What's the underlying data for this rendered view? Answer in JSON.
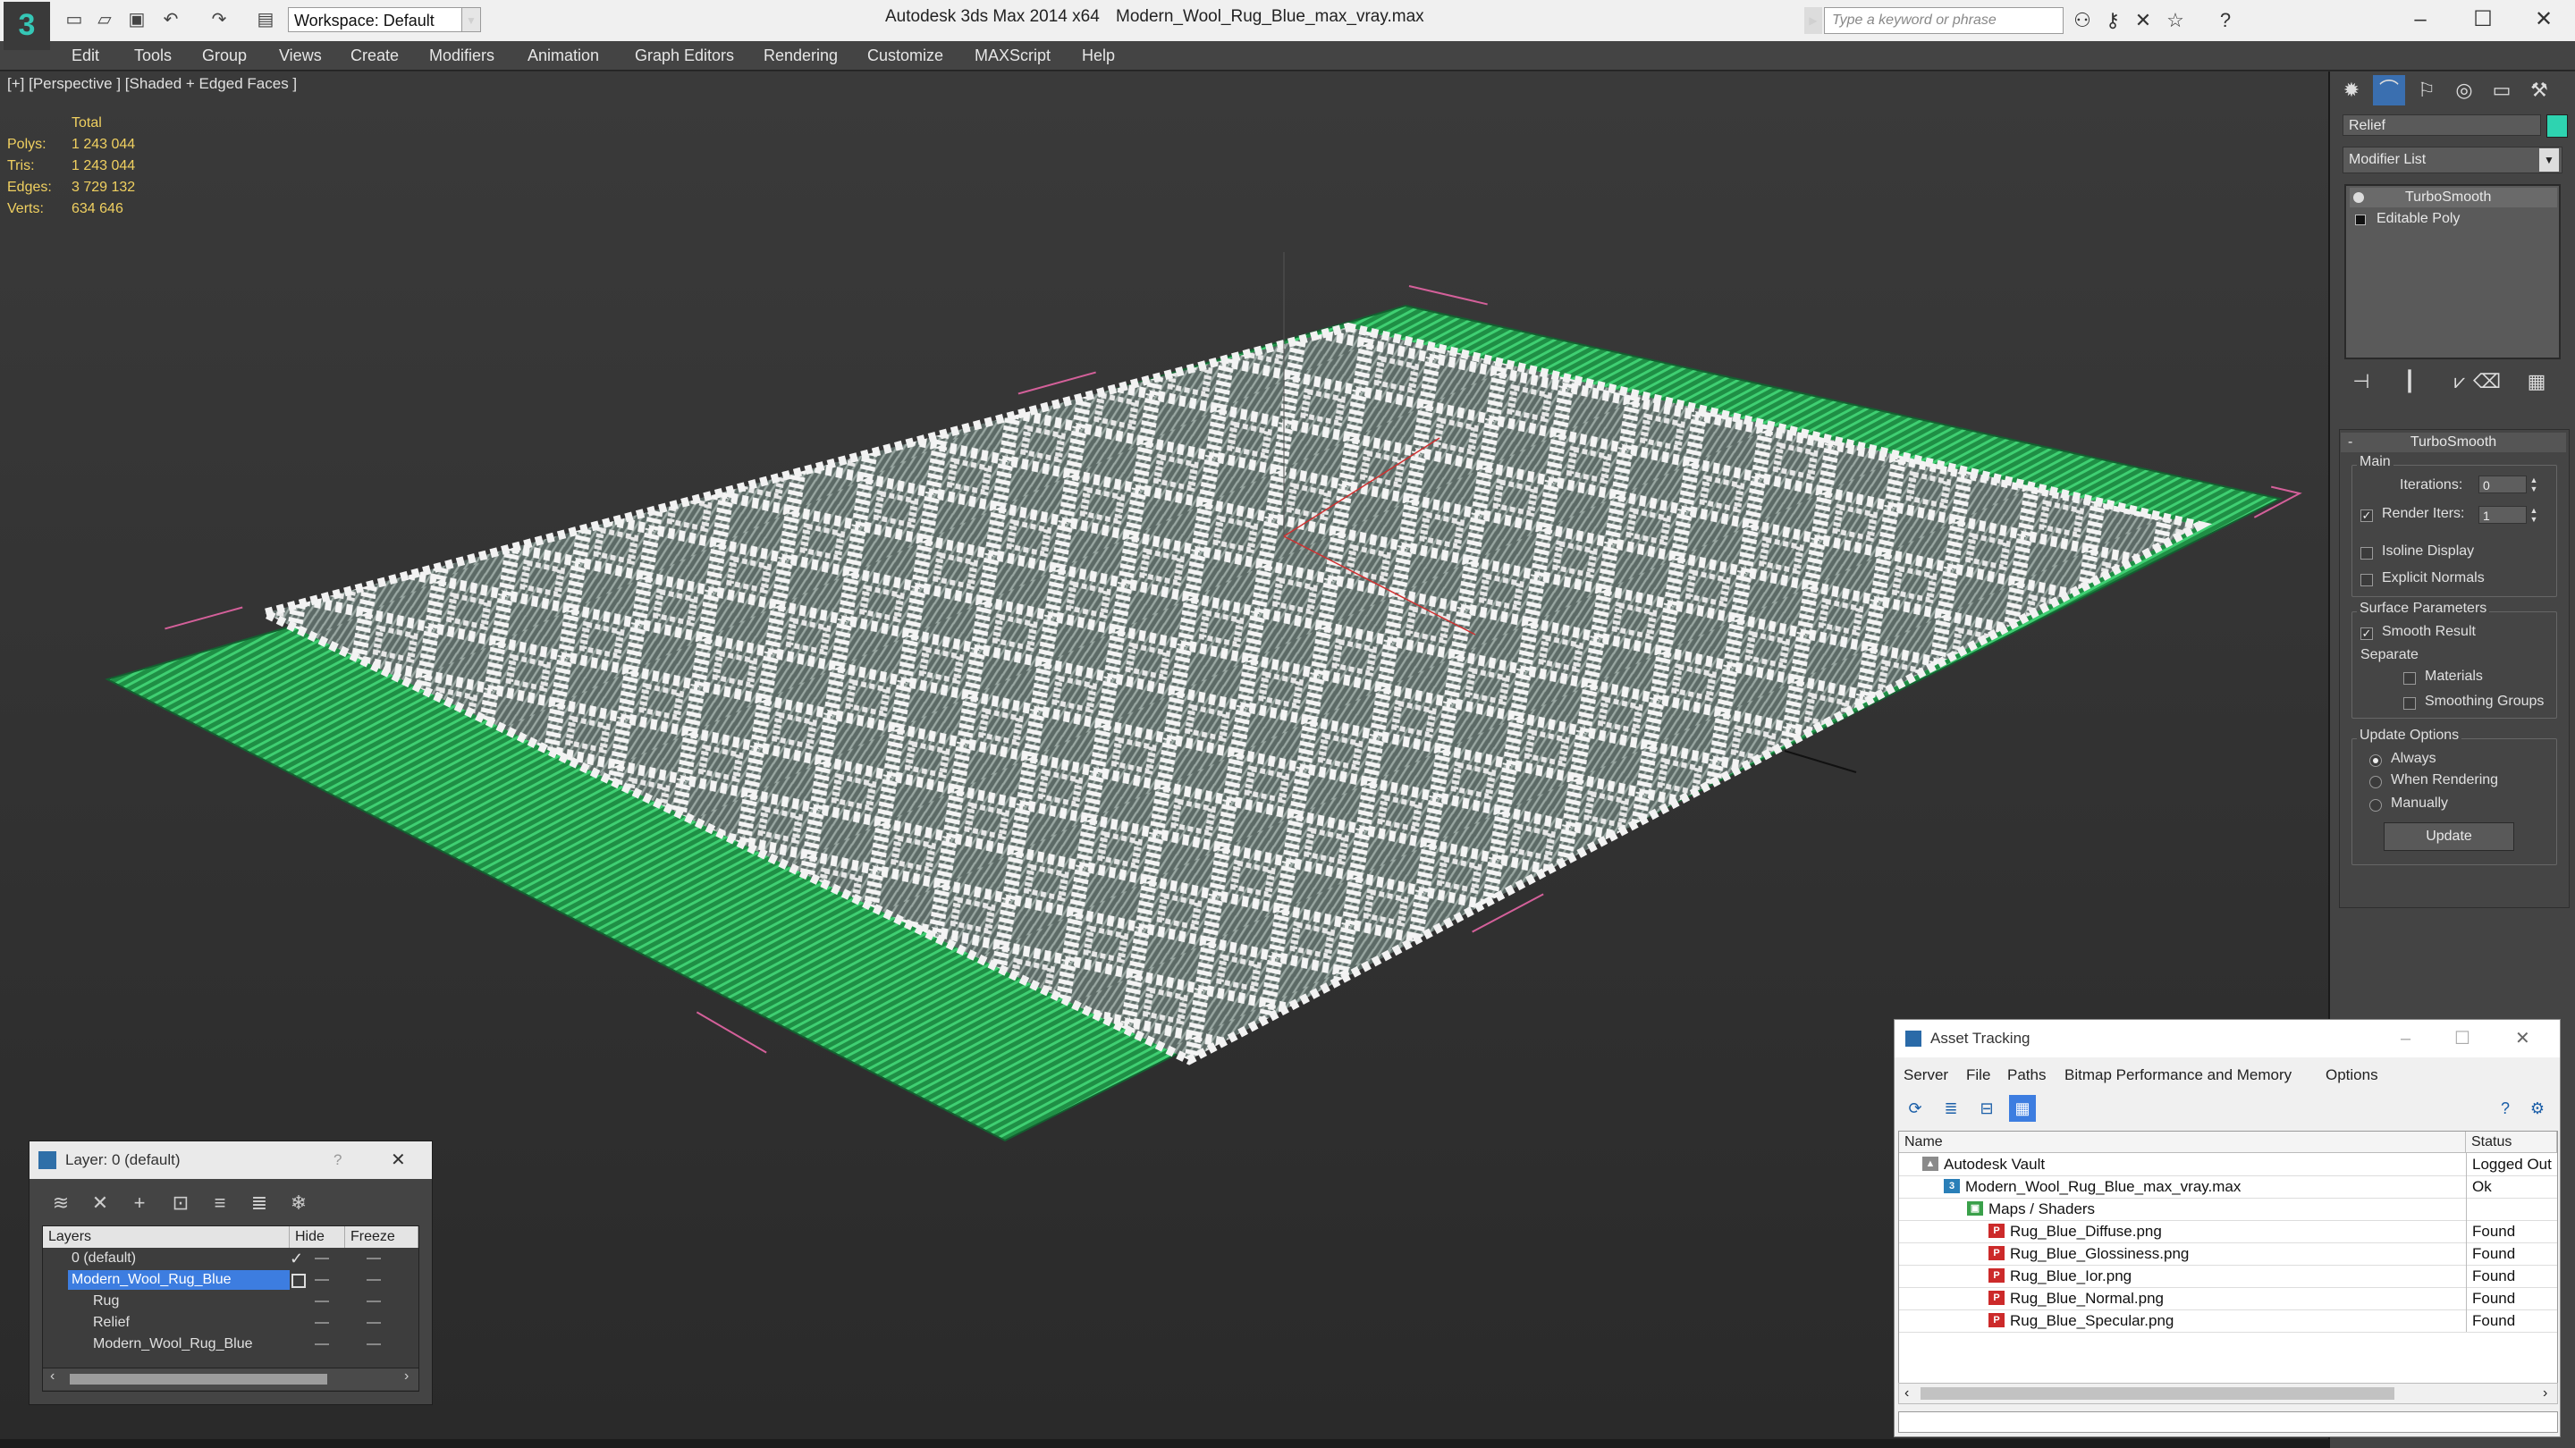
{
  "titlebar": {
    "workspace": "Workspace: Default",
    "app_title": "Autodesk 3ds Max  2014 x64",
    "doc_title": "Modern_Wool_Rug_Blue_max_vray.max",
    "search_placeholder": "Type a keyword or phrase"
  },
  "menu": [
    "Edit",
    "Tools",
    "Group",
    "Views",
    "Create",
    "Modifiers",
    "Animation",
    "Graph Editors",
    "Rendering",
    "Customize",
    "MAXScript",
    "Help"
  ],
  "viewport": {
    "label": "[+] [Perspective ] [Shaded + Edged Faces ]",
    "stats_header": "Total",
    "stats": [
      {
        "label": "Polys:",
        "value": "1 243 044"
      },
      {
        "label": "Tris:",
        "value": "1 243 044"
      },
      {
        "label": "Edges:",
        "value": "3 729 132"
      },
      {
        "label": "Verts:",
        "value": "634 646"
      }
    ]
  },
  "command_panel": {
    "object_name": "Relief",
    "object_color": "#2ed3b0",
    "modifier_list": "Modifier List",
    "stack": [
      "TurboSmooth",
      "Editable Poly"
    ],
    "rollout_title": "TurboSmooth",
    "main_group": "Main",
    "iterations_label": "Iterations:",
    "iterations_value": "0",
    "render_iters_label": "Render Iters:",
    "render_iters_value": "1",
    "isoline": "Isoline Display",
    "explicit_normals": "Explicit Normals",
    "surface_group": "Surface Parameters",
    "smooth_result": "Smooth Result",
    "separate": "Separate",
    "materials": "Materials",
    "smoothing_groups": "Smoothing Groups",
    "update_group": "Update Options",
    "always": "Always",
    "when_rendering": "When Rendering",
    "manually": "Manually",
    "update_button": "Update"
  },
  "layer_dialog": {
    "title": "Layer: 0 (default)",
    "help": "?",
    "col_layers": "Layers",
    "col_hide": "Hide",
    "col_freeze": "Freeze",
    "rows": [
      {
        "name": "0 (default)"
      },
      {
        "name": "Modern_Wool_Rug_Blue"
      },
      {
        "name": "Rug"
      },
      {
        "name": "Relief"
      },
      {
        "name": "Modern_Wool_Rug_Blue"
      }
    ]
  },
  "asset_tracking": {
    "title": "Asset Tracking",
    "menu": [
      "Server",
      "File",
      "Paths",
      "Bitmap Performance and Memory",
      "Options"
    ],
    "col_name": "Name",
    "col_status": "Status",
    "rows": [
      {
        "name": "Autodesk Vault",
        "status": "Logged Out"
      },
      {
        "name": "Modern_Wool_Rug_Blue_max_vray.max",
        "status": "Ok"
      },
      {
        "name": "Maps / Shaders",
        "status": ""
      },
      {
        "name": "Rug_Blue_Diffuse.png",
        "status": "Found"
      },
      {
        "name": "Rug_Blue_Glossiness.png",
        "status": "Found"
      },
      {
        "name": "Rug_Blue_Ior.png",
        "status": "Found"
      },
      {
        "name": "Rug_Blue_Normal.png",
        "status": "Found"
      },
      {
        "name": "Rug_Blue_Specular.png",
        "status": "Found"
      }
    ]
  }
}
